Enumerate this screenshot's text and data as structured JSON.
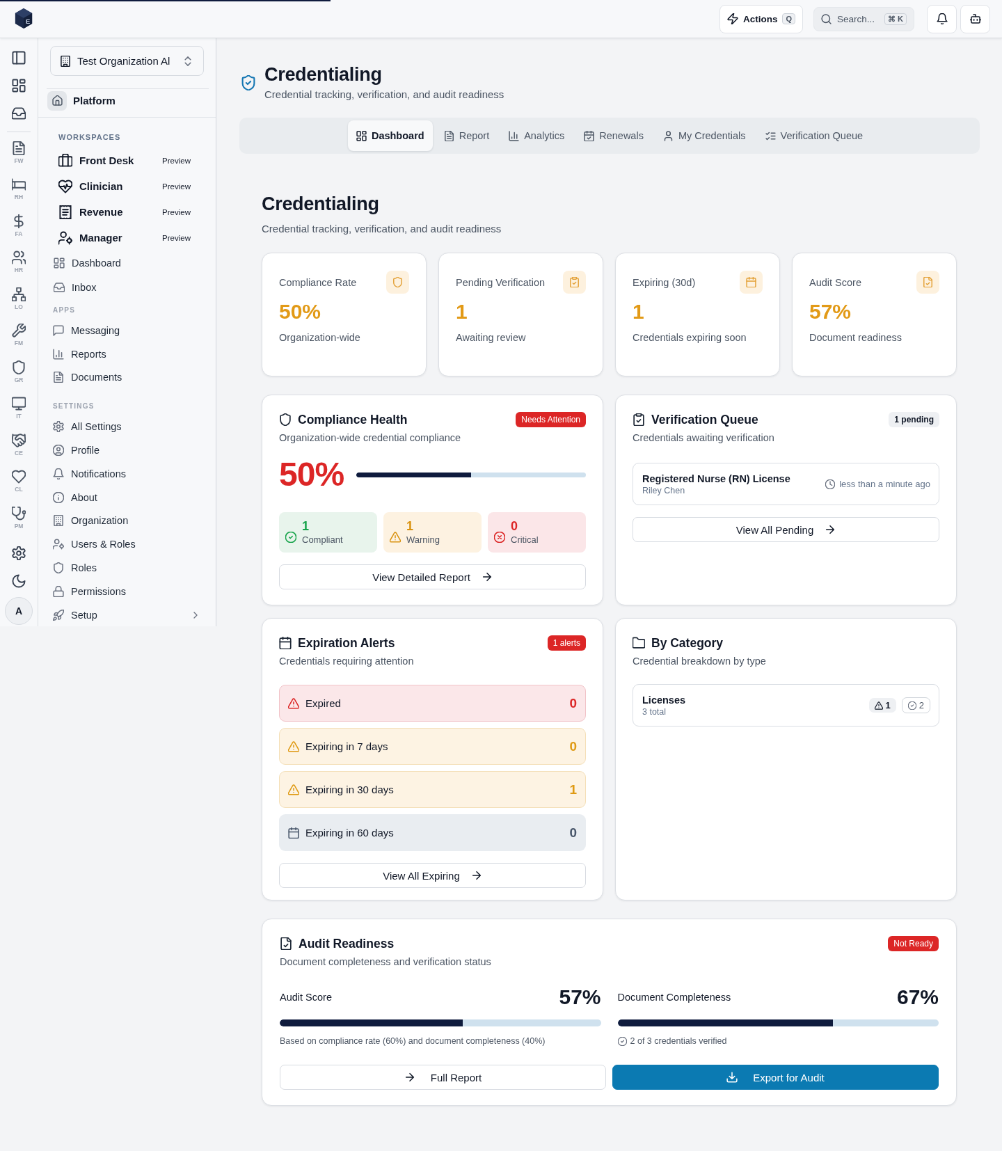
{
  "page_progress": {
    "level": 0.33
  },
  "logo": {
    "letter": "E"
  },
  "top_bar": {
    "actions": {
      "label": "Actions",
      "shortcut": "Q"
    },
    "search": {
      "label": "Search...",
      "shortcut": "⌘ K"
    }
  },
  "rail": {
    "modules": [
      {
        "label": "FW"
      },
      {
        "label": "RH"
      },
      {
        "label": "FA"
      },
      {
        "label": "HR"
      },
      {
        "label": "LO"
      },
      {
        "label": "FM"
      },
      {
        "label": "GR"
      },
      {
        "label": "IT"
      },
      {
        "label": "CE"
      },
      {
        "label": "CL"
      },
      {
        "label": "PM"
      }
    ],
    "avatar": "A"
  },
  "sidebar": {
    "organization": "Test Organization Al",
    "platform": "Platform",
    "groups": [
      {
        "heading": "WORKSPACES",
        "kind": "workspaces",
        "items": [
          {
            "label": "Front Desk",
            "kind": "workspace",
            "tag": "Preview"
          },
          {
            "label": "Clinician",
            "kind": "workspace",
            "tag": "Preview"
          },
          {
            "label": "Revenue",
            "kind": "workspace",
            "tag": "Preview"
          },
          {
            "label": "Manager",
            "kind": "workspace",
            "tag": "Preview"
          },
          {
            "label": "Dashboard",
            "kind": "link"
          },
          {
            "label": "Inbox",
            "kind": "link"
          }
        ]
      },
      {
        "heading": "APPS",
        "kind": "section",
        "items": [
          {
            "label": "Messaging",
            "kind": "link"
          },
          {
            "label": "Reports",
            "kind": "link"
          },
          {
            "label": "Documents",
            "kind": "link"
          }
        ]
      },
      {
        "heading": "SETTINGS",
        "kind": "section",
        "items": [
          {
            "label": "All Settings",
            "kind": "link"
          },
          {
            "label": "Profile",
            "kind": "link"
          },
          {
            "label": "Notifications",
            "kind": "link"
          },
          {
            "label": "About",
            "kind": "link"
          },
          {
            "label": "Organization",
            "kind": "link"
          },
          {
            "label": "Users & Roles",
            "kind": "link"
          },
          {
            "label": "Roles",
            "kind": "link"
          },
          {
            "label": "Permissions",
            "kind": "link"
          },
          {
            "label": "Setup",
            "kind": "submenu"
          }
        ]
      }
    ]
  },
  "header": {
    "title": "Credentialing",
    "subtitle": "Credential tracking, verification, and audit readiness"
  },
  "tabs": [
    {
      "label": "Dashboard",
      "selected": true
    },
    {
      "label": "Report",
      "selected": false
    },
    {
      "label": "Analytics",
      "selected": false
    },
    {
      "label": "Renewals",
      "selected": false
    },
    {
      "label": "My Credentials",
      "selected": false
    },
    {
      "label": "Verification Queue",
      "selected": false
    }
  ],
  "overview": {
    "title": "Credentialing",
    "subtitle": "Credential tracking, verification, and audit readiness"
  },
  "stats": [
    {
      "label": "Compliance Rate",
      "value": "50%",
      "caption": "Organization-wide"
    },
    {
      "label": "Pending Verification",
      "value": "1",
      "caption": "Awaiting review"
    },
    {
      "label": "Expiring (30d)",
      "value": "1",
      "caption": "Credentials expiring soon"
    },
    {
      "label": "Audit Score",
      "value": "57%",
      "caption": "Document readiness"
    }
  ],
  "compliance_health": {
    "title": "Compliance Health",
    "subtitle": "Organization-wide credential compliance",
    "badge": {
      "text": "Needs Attention",
      "kind": "danger"
    },
    "value": "50%",
    "level": 0.5,
    "counts": [
      {
        "kind": "compliant",
        "value": "1",
        "label": "Compliant"
      },
      {
        "kind": "warning",
        "value": "1",
        "label": "Warning"
      },
      {
        "kind": "critical",
        "value": "0",
        "label": "Critical"
      }
    ],
    "button": "View Detailed Report"
  },
  "verification_queue": {
    "title": "Verification Queue",
    "subtitle": "Credentials awaiting verification",
    "badge": {
      "text": "1 pending",
      "kind": "neutral"
    },
    "items": [
      {
        "title": "Registered Nurse (RN) License",
        "person": "Riley Chen",
        "time": "less than a minute ago"
      }
    ],
    "button": "View All Pending"
  },
  "expiration_alerts": {
    "title": "Expiration Alerts",
    "subtitle": "Credentials requiring attention",
    "badge": {
      "text": "1 alerts",
      "kind": "danger"
    },
    "rows": [
      {
        "kind": "expired",
        "label": "Expired",
        "value": "0"
      },
      {
        "kind": "warning",
        "label": "Expiring in 7 days",
        "value": "0"
      },
      {
        "kind": "warning",
        "label": "Expiring in 30 days",
        "value": "1"
      },
      {
        "kind": "upcoming",
        "label": "Expiring in 60 days",
        "value": "0"
      }
    ],
    "button": "View All Expiring"
  },
  "by_category": {
    "title": "By Category",
    "subtitle": "Credential breakdown by type",
    "items": [
      {
        "name": "Licenses",
        "total": "3 total",
        "warning_count": "1",
        "verified_count": "2"
      }
    ]
  },
  "audit_readiness": {
    "title": "Audit Readiness",
    "subtitle": "Document completeness and verification status",
    "badge": {
      "text": "Not Ready",
      "kind": "danger"
    },
    "metrics": [
      {
        "kind": "score",
        "label": "Audit Score",
        "value": "57%",
        "level": 0.57,
        "note": "Based on compliance rate (60%) and document completeness (40%)"
      },
      {
        "kind": "completeness",
        "label": "Document Completeness",
        "value": "67%",
        "level": 0.67,
        "note": "2 of 3 credentials verified"
      }
    ],
    "buttons": [
      {
        "kind": "secondary",
        "label": "Full Report"
      },
      {
        "kind": "primary",
        "label": "Export for Audit"
      }
    ]
  }
}
